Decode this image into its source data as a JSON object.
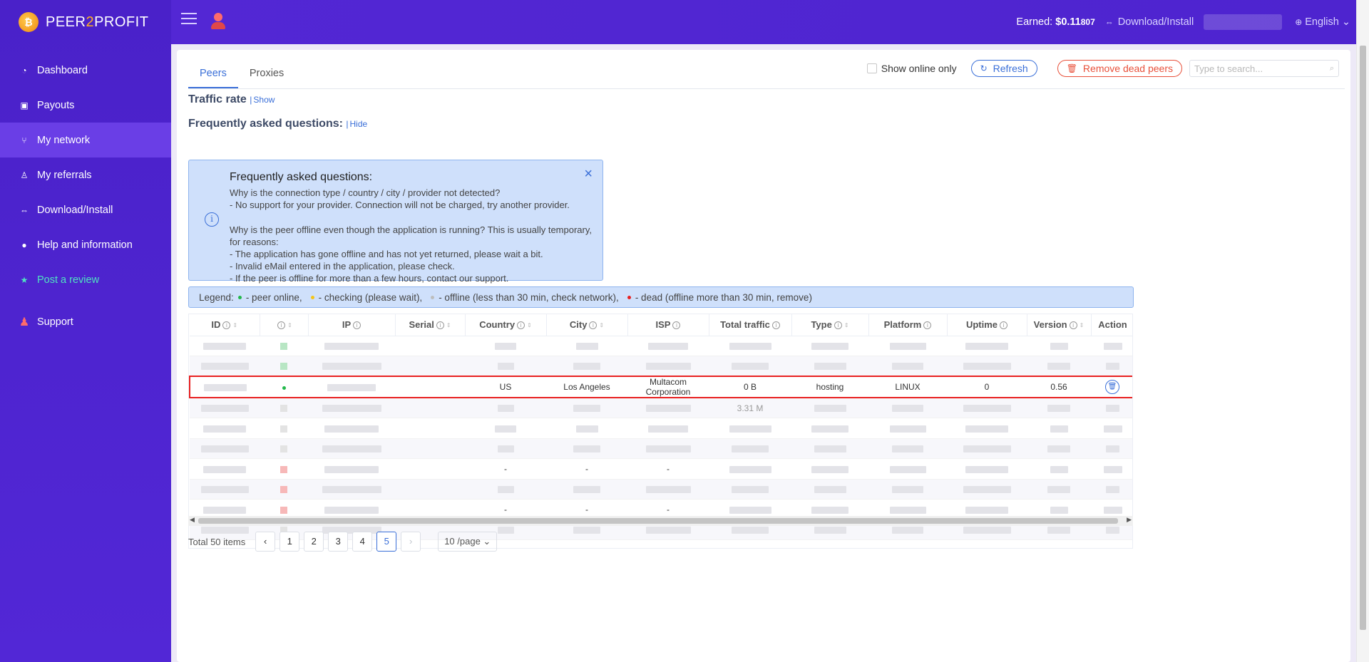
{
  "brand": {
    "name_part1": "PEER",
    "name_part2": "2",
    "name_part3": "PROFIT",
    "coin": "₿"
  },
  "sidebar": {
    "items": [
      {
        "label": "Dashboard",
        "icon": "gauge-icon",
        "glyph": "◔"
      },
      {
        "label": "Payouts",
        "icon": "wallet-icon",
        "glyph": "▣"
      },
      {
        "label": "My network",
        "icon": "network-icon",
        "glyph": "⑂"
      },
      {
        "label": "My referrals",
        "icon": "referrals-icon",
        "glyph": "♙"
      },
      {
        "label": "Download/Install",
        "icon": "download-icon",
        "glyph": "⇔"
      },
      {
        "label": "Help and information",
        "icon": "help-icon",
        "glyph": "●"
      },
      {
        "label": "Post a review",
        "icon": "star-icon",
        "glyph": "★"
      },
      {
        "label": "Support",
        "icon": "support-icon",
        "glyph": "♟"
      }
    ]
  },
  "header": {
    "earned_label": "Earned:",
    "earned_value": "$0.11",
    "earned_small": "807",
    "download": "Download/Install",
    "language": "English"
  },
  "tabs": [
    "Peers",
    "Proxies"
  ],
  "toolbar": {
    "show_online": "Show online only",
    "refresh": "Refresh",
    "remove_dead": "Remove dead peers",
    "search_placeholder": "Type to search..."
  },
  "traffic": {
    "title": "Traffic rate",
    "sep": "|",
    "toggle": "Show"
  },
  "faq": {
    "title": "Frequently asked questions:",
    "sep": "|",
    "toggle": "Hide",
    "box_title": "Frequently asked questions:",
    "lines": [
      "Why is the connection type / country / city / provider not detected?",
      "- No support for your provider. Connection will not be charged, try another provider.",
      "",
      "Why is the peer offline even though the application is running? This is usually temporary, for reasons:",
      "- The application has gone offline and has not yet returned, please wait a bit.",
      "- Invalid eMail entered in the application, please check.",
      "- If the peer is offline for more than a few hours, contact our support."
    ]
  },
  "legend": {
    "prefix": "Legend:",
    "items": [
      {
        "text": "- peer online,",
        "color": "#22b84a"
      },
      {
        "text": "- checking (please wait),",
        "color": "#f5c518"
      },
      {
        "text": "- offline (less than 30 min, check network),",
        "color": "#bdbdbd"
      },
      {
        "text": "- dead (offline more than 30 min, remove)",
        "color": "#e82020"
      }
    ]
  },
  "table": {
    "columns": [
      "ID",
      "",
      "IP",
      "Serial",
      "Country",
      "City",
      "ISP",
      "Total traffic",
      "Type",
      "Platform",
      "Uptime",
      "Version",
      "Action"
    ],
    "highlighted_row": {
      "country": "US",
      "city": "Los Angeles",
      "isp": "Multacom Corporation",
      "traffic": "0 B",
      "type": "hosting",
      "platform": "LINUX",
      "uptime": "0",
      "version": "0.56"
    },
    "status_colors": [
      "#b8e6c4",
      "#b8e6c4",
      "online",
      "#e3e3e3",
      "#e3e3e3",
      "#e3e3e3",
      "#f7b8b8",
      "#f7b8b8",
      "#f7b8b8",
      "#e3e3e3"
    ],
    "dash_text": "-",
    "partial_traffic": "3.31 M"
  },
  "pagination": {
    "total": "Total 50 items",
    "prev": "‹",
    "next": "›",
    "pages": [
      "1",
      "2",
      "3",
      "4",
      "5"
    ],
    "active": "5",
    "page_size": "10 /page"
  }
}
